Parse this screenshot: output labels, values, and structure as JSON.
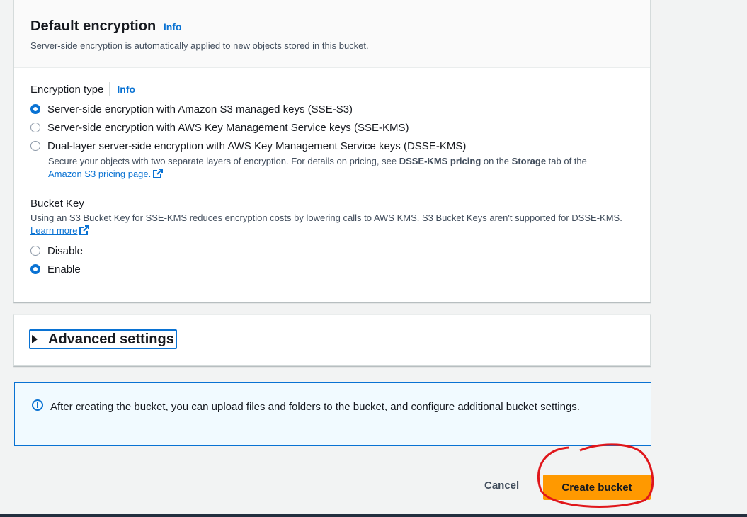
{
  "encryption": {
    "title": "Default encryption",
    "info": "Info",
    "description": "Server-side encryption is automatically applied to new objects stored in this bucket.",
    "type_label": "Encryption type",
    "type_info": "Info",
    "options": [
      {
        "label": "Server-side encryption with Amazon S3 managed keys (SSE-S3)",
        "selected": true
      },
      {
        "label": "Server-side encryption with AWS Key Management Service keys (SSE-KMS)",
        "selected": false
      },
      {
        "label": "Dual-layer server-side encryption with AWS Key Management Service keys (DSSE-KMS)",
        "selected": false
      }
    ],
    "dsse_desc_1": "Secure your objects with two separate layers of encryption. For details on pricing, see ",
    "dsse_desc_bold1": "DSSE-KMS pricing",
    "dsse_desc_2": " on the ",
    "dsse_desc_bold2": "Storage",
    "dsse_desc_3": " tab of the ",
    "pricing_link": "Amazon S3 pricing page."
  },
  "bucket_key": {
    "label": "Bucket Key",
    "description": "Using an S3 Bucket Key for SSE-KMS reduces encryption costs by lowering calls to AWS KMS. S3 Bucket Keys aren't supported for DSSE-KMS.",
    "learn_more": "Learn more",
    "options": [
      {
        "label": "Disable",
        "selected": false
      },
      {
        "label": "Enable",
        "selected": true
      }
    ]
  },
  "advanced": {
    "label": "Advanced settings"
  },
  "alert": {
    "text": "After creating the bucket, you can upload files and folders to the bucket, and configure additional bucket settings."
  },
  "actions": {
    "cancel": "Cancel",
    "create": "Create bucket"
  },
  "colors": {
    "accent": "#0972d3",
    "primary_button": "#ff9900",
    "annotation": "#e0161b"
  }
}
